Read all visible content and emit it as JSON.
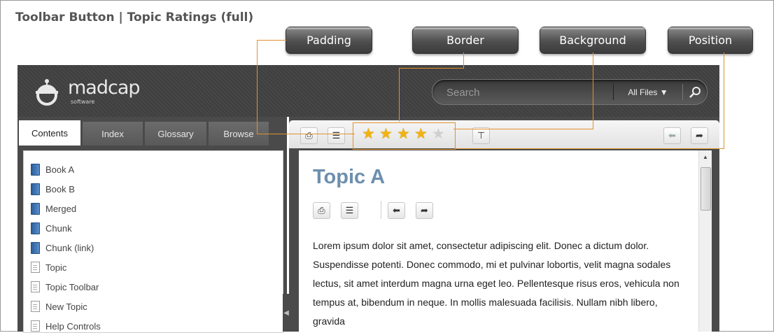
{
  "title": "Toolbar Button | Topic Ratings (full)",
  "callouts": {
    "padding": "Padding",
    "border": "Border",
    "background": "Background",
    "position": "Position"
  },
  "header": {
    "logo_text": "madcap",
    "logo_sub": "software",
    "search_placeholder": "Search",
    "search_filter": "All Files ▼"
  },
  "tabs": [
    "Contents",
    "Index",
    "Glossary",
    "Browse"
  ],
  "toc": [
    {
      "label": "Book A",
      "icon": "book-icon"
    },
    {
      "label": "Book B",
      "icon": "book-icon"
    },
    {
      "label": "Merged",
      "icon": "book-icon"
    },
    {
      "label": "Chunk",
      "icon": "book-icon"
    },
    {
      "label": "Chunk (link)",
      "icon": "book-icon"
    },
    {
      "label": "Topic",
      "icon": "page-icon"
    },
    {
      "label": "Topic Toolbar",
      "icon": "page-icon"
    },
    {
      "label": "New Topic",
      "icon": "page-icon"
    },
    {
      "label": "Help Controls",
      "icon": "page-icon"
    }
  ],
  "rating": {
    "stars_filled": 4,
    "stars_total": 5
  },
  "topic": {
    "title": "Topic A",
    "body": "Lorem ipsum dolor sit amet, consectetur adipiscing elit. Donec a dictum dolor. Suspendisse potenti. Donec commodo, mi et pulvinar lobortis, velit magna sodales lectus, sit amet interdum magna urna eget leo. Pellentesque risus eros, vehicula non tempus at, bibendum in neque. In mollis malesuada facilisis. Nullam nibh libero, gravida"
  },
  "colors": {
    "accent_line": "#e0922f",
    "header_bg": "#444444",
    "topic_title": "#6d8fae",
    "star": "#f2b310"
  }
}
